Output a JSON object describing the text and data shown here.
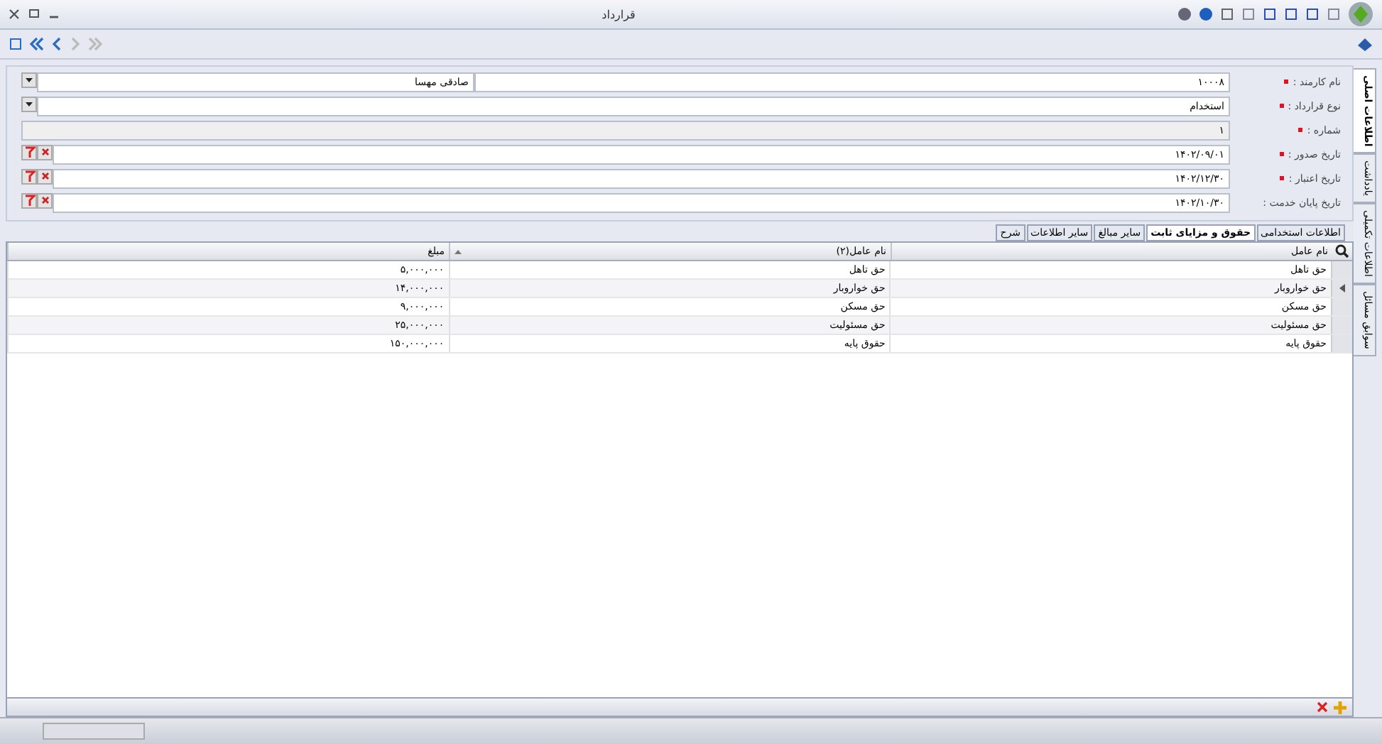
{
  "window": {
    "title": "قرارداد"
  },
  "side_tabs": [
    {
      "label": "اطلاعات اصلی",
      "selected": true
    },
    {
      "label": "یادداشت",
      "selected": false
    },
    {
      "label": "اطلاعات تکمیلی",
      "selected": false
    },
    {
      "label": "سوابق مسائل",
      "selected": false
    }
  ],
  "form": {
    "fields": [
      {
        "kind": "lookup",
        "label": "نام کارمند :",
        "required": true,
        "value": "۱۰۰۰۸",
        "value_2": "صادقی مهسا"
      },
      {
        "kind": "dropdown",
        "label": "نوع قرارداد :",
        "required": true,
        "value": "استخدام"
      },
      {
        "kind": "readonly",
        "label": "شماره :",
        "required": true,
        "value": "۱"
      },
      {
        "kind": "date",
        "label": "تاریخ صدور :",
        "required": true,
        "value": "۱۴۰۲/۰۹/۰۱"
      },
      {
        "kind": "date",
        "label": "تاریخ اعتبار :",
        "required": true,
        "value": "۱۴۰۲/۱۲/۳۰"
      },
      {
        "kind": "date",
        "label": "تاریخ پایان خدمت :",
        "required": false,
        "value": "۱۴۰۲/۱۰/۳۰"
      }
    ]
  },
  "tabs": [
    {
      "label": "اطلاعات استخدامی",
      "selected": false
    },
    {
      "label": "حقوق و مزایای ثابت",
      "selected": true
    },
    {
      "label": "سایر مبالغ",
      "selected": false
    },
    {
      "label": "سایر اطلاعات",
      "selected": false
    },
    {
      "label": "شرح",
      "selected": false
    }
  ],
  "table": {
    "columns": [
      "نام عامل",
      "نام عامل(۲)",
      "مبلغ"
    ],
    "rows": [
      {
        "cells": [
          "حق تاهل",
          "حق تاهل",
          "۵,۰۰۰,۰۰۰"
        ],
        "current": false
      },
      {
        "cells": [
          "حق خواروبار",
          "حق خواروبار",
          "۱۴,۰۰۰,۰۰۰"
        ],
        "current": true
      },
      {
        "cells": [
          "حق مسکن",
          "حق مسکن",
          "۹,۰۰۰,۰۰۰"
        ],
        "current": false
      },
      {
        "cells": [
          "حق مسئولیت",
          "حق مسئولیت",
          "۲۵,۰۰۰,۰۰۰"
        ],
        "current": false
      },
      {
        "cells": [
          "حقوق پایه",
          "حقوق پایه",
          "۱۵۰,۰۰۰,۰۰۰"
        ],
        "current": false
      }
    ]
  }
}
